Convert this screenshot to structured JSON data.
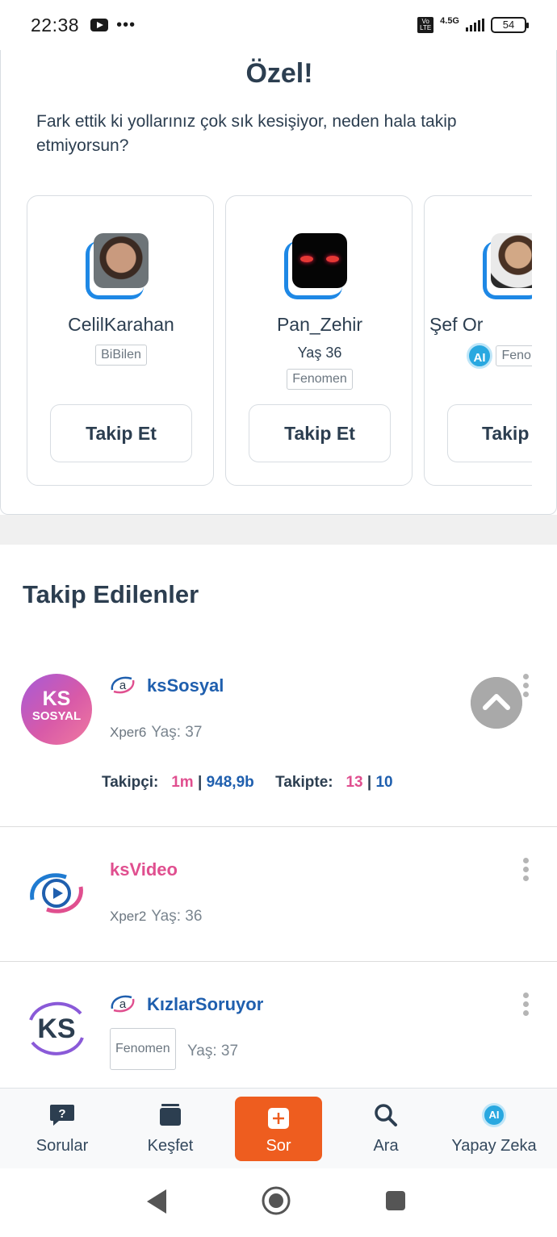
{
  "status_bar": {
    "time": "22:38",
    "volte": "Vo LTE",
    "network": "4.5G",
    "battery": "54"
  },
  "special": {
    "title": "Özel!",
    "description": "Fark ettik ki yollarınız çok sık kesişiyor, neden hala takip etmiyorsun?",
    "suggestions": [
      {
        "name": "CelilKarahan",
        "age": "",
        "badge": "BiBilen",
        "button": "Takip Et"
      },
      {
        "name": "Pan_Zehir",
        "age": "Yaş 36",
        "badge": "Fenomen",
        "button": "Takip Et"
      },
      {
        "name": "Şef Or",
        "age": "",
        "badge": "Feno",
        "ai_badge": "AI",
        "button": "Takip"
      }
    ]
  },
  "followed": {
    "title": "Takip Edilenler",
    "users": [
      {
        "name": "ksSosyal",
        "avatar_l1": "KS",
        "avatar_l2": "SOSYAL",
        "xper": "Xper6",
        "age": "Yaş: 37",
        "stats": {
          "followers_label": "Takipçi:",
          "followers_a": "1m",
          "sep": "|",
          "followers_b": "948,9b",
          "following_label": "Takipte:",
          "following_a": "13",
          "following_b": "10"
        }
      },
      {
        "name": "ksVideo",
        "xper": "Xper2",
        "age": "Yaş: 36"
      },
      {
        "name": "KızlarSoruyor",
        "avatar_text": "KS",
        "badge": "Fenomen",
        "age": "Yaş: 37"
      }
    ]
  },
  "bottom_nav": {
    "items": [
      {
        "label": "Sorular",
        "icon": "question-bubble-icon"
      },
      {
        "label": "Keşfet",
        "icon": "stack-icon"
      },
      {
        "label": "Sor",
        "icon": "plus-square-icon"
      },
      {
        "label": "Ara",
        "icon": "search-icon"
      },
      {
        "label": "Yapay Zeka",
        "icon": "ai-icon",
        "icon_text": "AI"
      }
    ]
  },
  "colors": {
    "accent_orange": "#ee5d1f",
    "brand_blue": "#1f5fae",
    "brand_pink": "#e04f8f",
    "ring_blue": "#1e88e5"
  }
}
